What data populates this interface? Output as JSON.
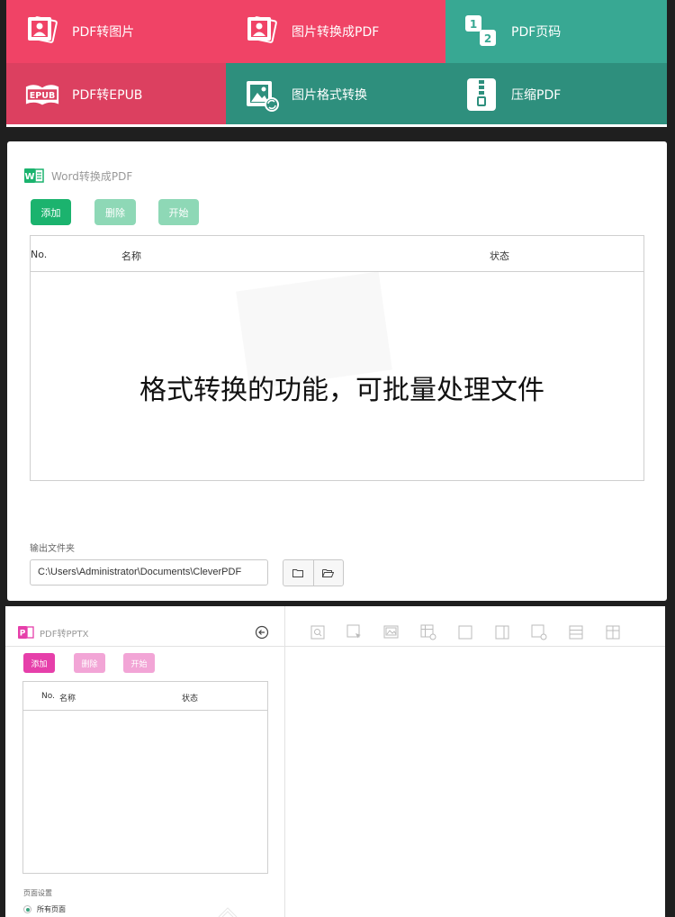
{
  "tiles": [
    {
      "label": "PDF转图片",
      "icon": "pdf-to-image-icon",
      "color": "#f04366"
    },
    {
      "label": "图片转换成PDF",
      "icon": "image-to-pdf-icon",
      "color": "#f04366"
    },
    {
      "label": "PDF页码",
      "icon": "page-number-icon",
      "color": "#38a893"
    },
    {
      "label": "PDF转EPUB",
      "icon": "epub-icon",
      "color": "#dc4060"
    },
    {
      "label": "图片格式转换",
      "icon": "image-format-convert-icon",
      "color": "#2e8f7d"
    },
    {
      "label": "压缩PDF",
      "icon": "compress-icon",
      "color": "#2e8f7d"
    }
  ],
  "page_number_icon_digits": [
    "1",
    "2"
  ],
  "epub_badge": "EPUB",
  "word_panel": {
    "title": "Word转换成PDF",
    "add_label": "添加",
    "delete_label": "删除",
    "start_label": "开始",
    "columns": {
      "no": "No.",
      "name": "名称",
      "status": "状态"
    },
    "overlay_text": "格式转换的功能，可批量处理文件",
    "output_label": "输出文件夹",
    "output_path": "C:\\Users\\Administrator\\Documents\\CleverPDF",
    "accent": "#1bb36e"
  },
  "pptx_panel": {
    "title": "PDF转PPTX",
    "add_label": "添加",
    "delete_label": "删除",
    "start_label": "开始",
    "columns": {
      "no": "No.",
      "name": "名称",
      "status": "状态"
    },
    "page_settings_label": "页面设置",
    "all_pages_label": "所有页面",
    "accent": "#e63faa",
    "toolbar_icons": [
      "zoom-icon",
      "select-icon",
      "image-icon",
      "table-add-icon",
      "rectangle-icon",
      "page-icon",
      "page-add-icon",
      "table-row-icon",
      "table-grid-icon"
    ]
  }
}
